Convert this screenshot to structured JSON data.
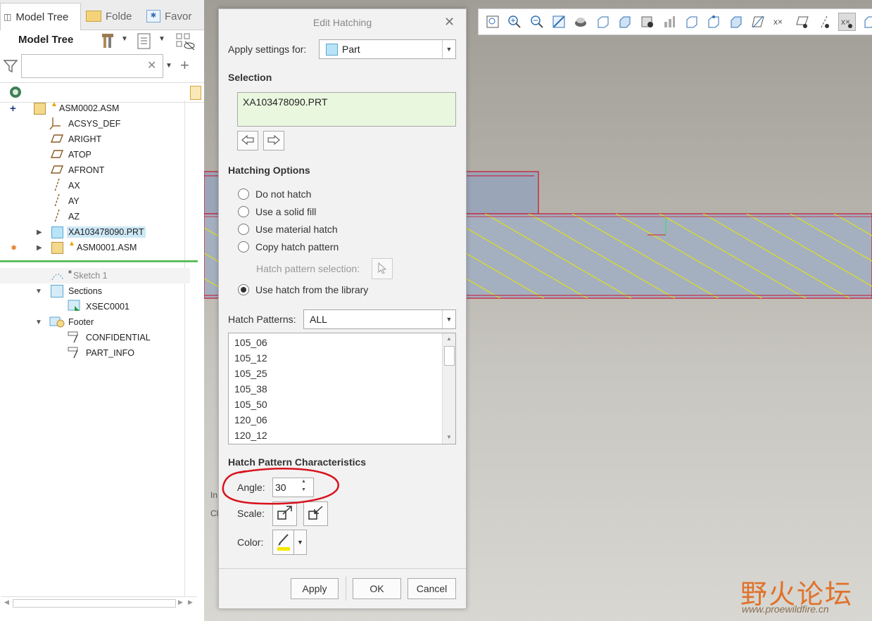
{
  "left_panel": {
    "tabs": [
      "Model Tree",
      "Folde",
      "Favor"
    ],
    "title": "Model Tree",
    "filter_placeholder": "",
    "tree": [
      {
        "label": "ASM0002.ASM"
      },
      {
        "label": "ACSYS_DEF"
      },
      {
        "label": "ARIGHT"
      },
      {
        "label": "ATOP"
      },
      {
        "label": "AFRONT"
      },
      {
        "label": "AX"
      },
      {
        "label": "AY"
      },
      {
        "label": "AZ"
      },
      {
        "label": "XA103478090.PRT"
      },
      {
        "label": "ASM0001.ASM"
      }
    ],
    "tree_lower": [
      {
        "label": "Sketch 1"
      },
      {
        "label": "Sections"
      },
      {
        "label": "XSEC0001"
      },
      {
        "label": "Footer"
      },
      {
        "label": "CONFIDENTIAL"
      },
      {
        "label": "PART_INFO"
      }
    ]
  },
  "viewport": {
    "partial_labels": [
      "In",
      "Cl"
    ]
  },
  "dialog": {
    "title": "Edit Hatching",
    "apply_settings_label": "Apply settings for:",
    "apply_settings_value": "Part",
    "selection_header": "Selection",
    "selection_value": "XA103478090.PRT",
    "hatching_options_header": "Hatching Options",
    "options": [
      "Do not hatch",
      "Use a solid fill",
      "Use material hatch",
      "Copy hatch pattern"
    ],
    "hatch_pattern_selection_label": "Hatch pattern selection:",
    "library_option": "Use hatch from the library",
    "selected_option": "Use hatch from the library",
    "hatch_patterns_label": "Hatch Patterns:",
    "hatch_patterns_value": "ALL",
    "patterns": [
      "105_06",
      "105_12",
      "105_25",
      "105_38",
      "105_50",
      "120_06",
      "120_12"
    ],
    "characteristics_header": "Hatch Pattern Characteristics",
    "angle_label": "Angle:",
    "angle_value": "30",
    "scale_label": "Scale:",
    "color_label": "Color:",
    "hatch_color": "#f5e800",
    "apply_label": "Apply",
    "ok_label": "OK",
    "cancel_label": "Cancel"
  },
  "watermark": {
    "chinese": "野火论坛",
    "url": "www.proewildfire.cn"
  },
  "colors": {
    "annotation_red": "#d8141e",
    "part_edge": "#c8102e",
    "hatch_line": "#e9e600"
  }
}
